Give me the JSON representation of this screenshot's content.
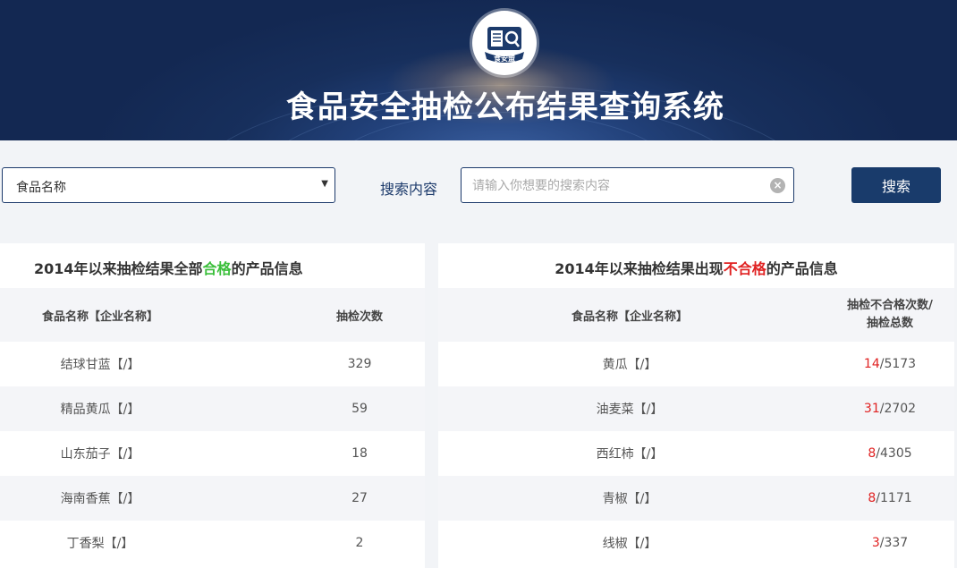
{
  "header": {
    "title": "食品安全抽检公布结果查询系统",
    "logo_text": "食安盟"
  },
  "search": {
    "category_selected": "食品名称",
    "label": "搜索内容",
    "placeholder": "请输入你想要的搜索内容",
    "value": "",
    "button": "搜索"
  },
  "left_panel": {
    "title_prefix": "2014年以来抽检结果全部",
    "title_highlight": "合格",
    "title_suffix": "的产品信息",
    "columns": [
      "食品名称【企业名称】",
      "抽检次数"
    ],
    "rows": [
      {
        "name": "结球甘蓝【/】",
        "count": "329"
      },
      {
        "name": "精品黄瓜【/】",
        "count": "59"
      },
      {
        "name": "山东茄子【/】",
        "count": "18"
      },
      {
        "name": "海南香蕉【/】",
        "count": "27"
      },
      {
        "name": "丁香梨【/】",
        "count": "2"
      }
    ]
  },
  "right_panel": {
    "title_prefix": "2014年以来抽检结果出现",
    "title_highlight": "不合格",
    "title_suffix": "的产品信息",
    "columns": [
      "食品名称【企业名称】",
      "抽检不合格次数/",
      "抽检总数"
    ],
    "rows": [
      {
        "name": "黄瓜【/】",
        "fail": "14",
        "total": "/5173"
      },
      {
        "name": "油麦菜【/】",
        "fail": "31",
        "total": "/2702"
      },
      {
        "name": "西红柿【/】",
        "fail": "8",
        "total": "/4305"
      },
      {
        "name": "青椒【/】",
        "fail": "8",
        "total": "/1171"
      },
      {
        "name": "线椒【/】",
        "fail": "3",
        "total": "/337"
      }
    ]
  },
  "colors": {
    "brand_navy": "#193b6b",
    "pass_green": "#3bbf3b",
    "fail_red": "#e02222"
  }
}
